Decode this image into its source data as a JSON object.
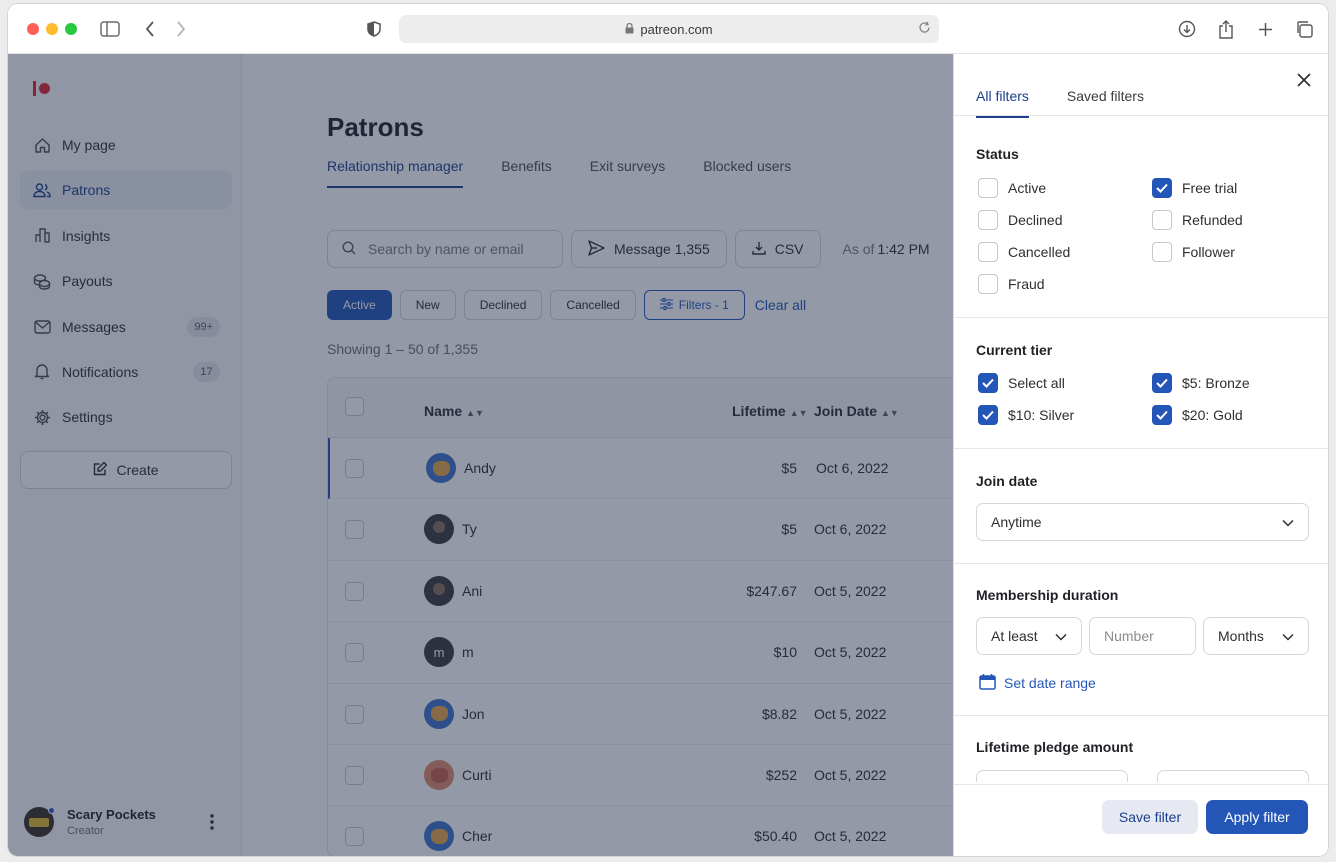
{
  "browser": {
    "url": "patreon.com"
  },
  "sidebar": {
    "items": [
      {
        "label": "My page",
        "icon": "home-icon"
      },
      {
        "label": "Patrons",
        "icon": "people-icon",
        "active": true
      },
      {
        "label": "Insights",
        "icon": "bar-chart-icon"
      },
      {
        "label": "Payouts",
        "icon": "coins-icon"
      },
      {
        "label": "Messages",
        "icon": "mail-icon",
        "badge": "99+"
      },
      {
        "label": "Notifications",
        "icon": "bell-icon",
        "badge": "17"
      },
      {
        "label": "Settings",
        "icon": "gear-icon"
      }
    ],
    "create_label": "Create",
    "profile": {
      "name": "Scary Pockets",
      "role": "Creator"
    }
  },
  "main": {
    "title": "Patrons",
    "tabs": [
      {
        "label": "Relationship manager",
        "active": true
      },
      {
        "label": "Benefits"
      },
      {
        "label": "Exit surveys"
      },
      {
        "label": "Blocked users"
      }
    ],
    "search_placeholder": "Search by name or email",
    "message_label": "Message 1,355",
    "csv_label": "CSV",
    "as_of_label": "As of",
    "as_of_time": "1:42 PM",
    "chips": {
      "active": "Active",
      "new": "New",
      "declined": "Declined",
      "cancelled": "Cancelled",
      "filters": "Filters - 1"
    },
    "clear_all": "Clear all",
    "showing": "Showing 1 – 50 of 1,355",
    "columns": {
      "name": "Name",
      "lifetime": "Lifetime",
      "join_date": "Join Date"
    },
    "rows": [
      {
        "name": "Andy",
        "lifetime": "$5",
        "join_date": "Oct 6, 2022",
        "avatar": "cat-avatar"
      },
      {
        "name": "Ty",
        "lifetime": "$5",
        "join_date": "Oct 6, 2022",
        "avatar": "photo-avatar"
      },
      {
        "name": "Ani",
        "lifetime": "$247.67",
        "join_date": "Oct 5, 2022",
        "avatar": "photo-avatar"
      },
      {
        "name": "m",
        "lifetime": "$10",
        "join_date": "Oct 5, 2022",
        "avatar": "letter-avatar",
        "initial": "m"
      },
      {
        "name": "Jon",
        "lifetime": "$8.82",
        "join_date": "Oct 5, 2022",
        "avatar": "cat-avatar"
      },
      {
        "name": "Curti",
        "lifetime": "$252",
        "join_date": "Oct 5, 2022",
        "avatar": "pink-cat-avatar"
      },
      {
        "name": "Cher",
        "lifetime": "$50.40",
        "join_date": "Oct 5, 2022",
        "avatar": "cat-avatar"
      }
    ]
  },
  "filters": {
    "tabs": {
      "all": "All filters",
      "saved": "Saved filters"
    },
    "status": {
      "title": "Status",
      "options": [
        {
          "label": "Active",
          "checked": false
        },
        {
          "label": "Free trial",
          "checked": true
        },
        {
          "label": "Declined",
          "checked": false
        },
        {
          "label": "Refunded",
          "checked": false
        },
        {
          "label": "Cancelled",
          "checked": false
        },
        {
          "label": "Follower",
          "checked": false
        },
        {
          "label": "Fraud",
          "checked": false
        }
      ]
    },
    "tier": {
      "title": "Current tier",
      "options": [
        {
          "label": "Select all",
          "checked": true
        },
        {
          "label": "$5: Bronze",
          "checked": true
        },
        {
          "label": "$10: Silver",
          "checked": true
        },
        {
          "label": "$20: Gold",
          "checked": true
        }
      ]
    },
    "join_date": {
      "title": "Join date",
      "value": "Anytime"
    },
    "duration": {
      "title": "Membership duration",
      "comparator": "At least",
      "number_placeholder": "Number",
      "unit": "Months",
      "set_range": "Set date range"
    },
    "lifetime": {
      "title": "Lifetime pledge amount"
    },
    "save_label": "Save filter",
    "apply_label": "Apply filter"
  },
  "colors": {
    "accent": "#2456b8",
    "brand": "#e0262e"
  }
}
